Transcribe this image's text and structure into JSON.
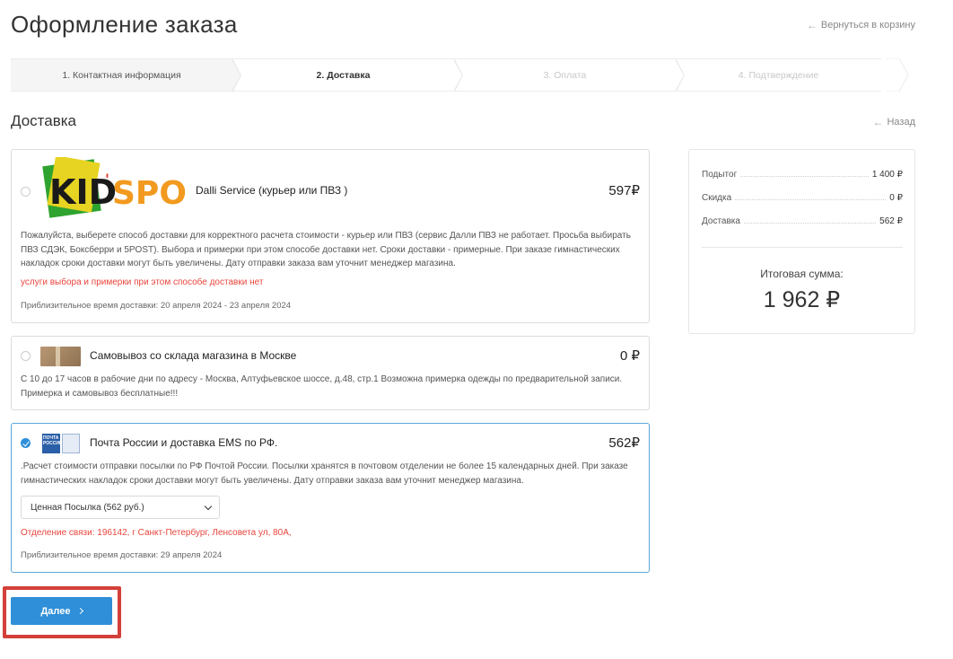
{
  "header": {
    "title": "Оформление заказа",
    "back_to_cart": "Вернуться в корзину"
  },
  "steps": [
    {
      "label": "1. Контактная информация",
      "state": "done"
    },
    {
      "label": "2. Доставка",
      "state": "active"
    },
    {
      "label": "3. Оплата",
      "state": "inactive"
    },
    {
      "label": "4. Подтверждение",
      "state": "inactive"
    }
  ],
  "section": {
    "title": "Доставка",
    "back": "Назад"
  },
  "methods": [
    {
      "logo_text": "KID'SPORT",
      "name": "Dalli Service (курьер или ПВЗ )",
      "price": "597₽",
      "selected": false,
      "description": "Пожалуйста, выберете способ доставки для корректного расчета стоимости - курьер или ПВЗ (сервис Далли ПВЗ не работает. Просьба выбирать ПВЗ СДЭК, Боксберри и 5POST). Выбора и примерки при этом способе доставки нет. Сроки доставки - примерные. При заказе гимнастических накладок сроки доставки могут быть увеличены. Дату отправки заказа вам уточнит менеджер магазина.",
      "note": "услуги выбора и примерки при этом способе доставки нет",
      "estimate": "Приблизительное время доставки: 20 апреля 2024 - 23 апреля 2024"
    },
    {
      "name": "Самовывоз со склада магазина в Москве",
      "price": "0 ₽",
      "selected": false,
      "description": "С 10 до 17 часов в рабочие дни по адресу - Москва, Алтуфьевское шоссе, д.48, стр.1 Возможна примерка одежды по предварительной записи. Примерка и самовывоз бесплатные!!!"
    },
    {
      "logo_text": "ПОЧТА РОССИИ",
      "name": "Почта России и доставка EMS по РФ.",
      "price": "562₽",
      "selected": true,
      "description": ".Расчет стоимости отправки посылки по РФ Почтой России. Посылки хранятся в почтовом отделении не более 15 календарных дней. При заказе гимнастических накладок сроки доставки могут быть увеличены. Дату отправки заказа вам уточнит менеджер магазина.",
      "select_value": "Ценная Посылка (562 руб.)",
      "note": "Отделение связи: 196142, г Санкт-Петербург, Ленсовета ул, 80А,",
      "estimate": "Приблизительное время доставки: 29 апреля 2024"
    }
  ],
  "summary": {
    "subtotal_label": "Подытог",
    "subtotal_value": "1 400 ₽",
    "discount_label": "Скидка",
    "discount_value": "0 ₽",
    "delivery_label": "Доставка",
    "delivery_value": "562 ₽",
    "total_label": "Итоговая сумма:",
    "total_value": "1 962 ₽"
  },
  "actions": {
    "next_label": "Далее"
  },
  "colors": {
    "accent": "#2f8fd8",
    "warning": "#e8453c",
    "highlight_frame": "#d3403a"
  }
}
